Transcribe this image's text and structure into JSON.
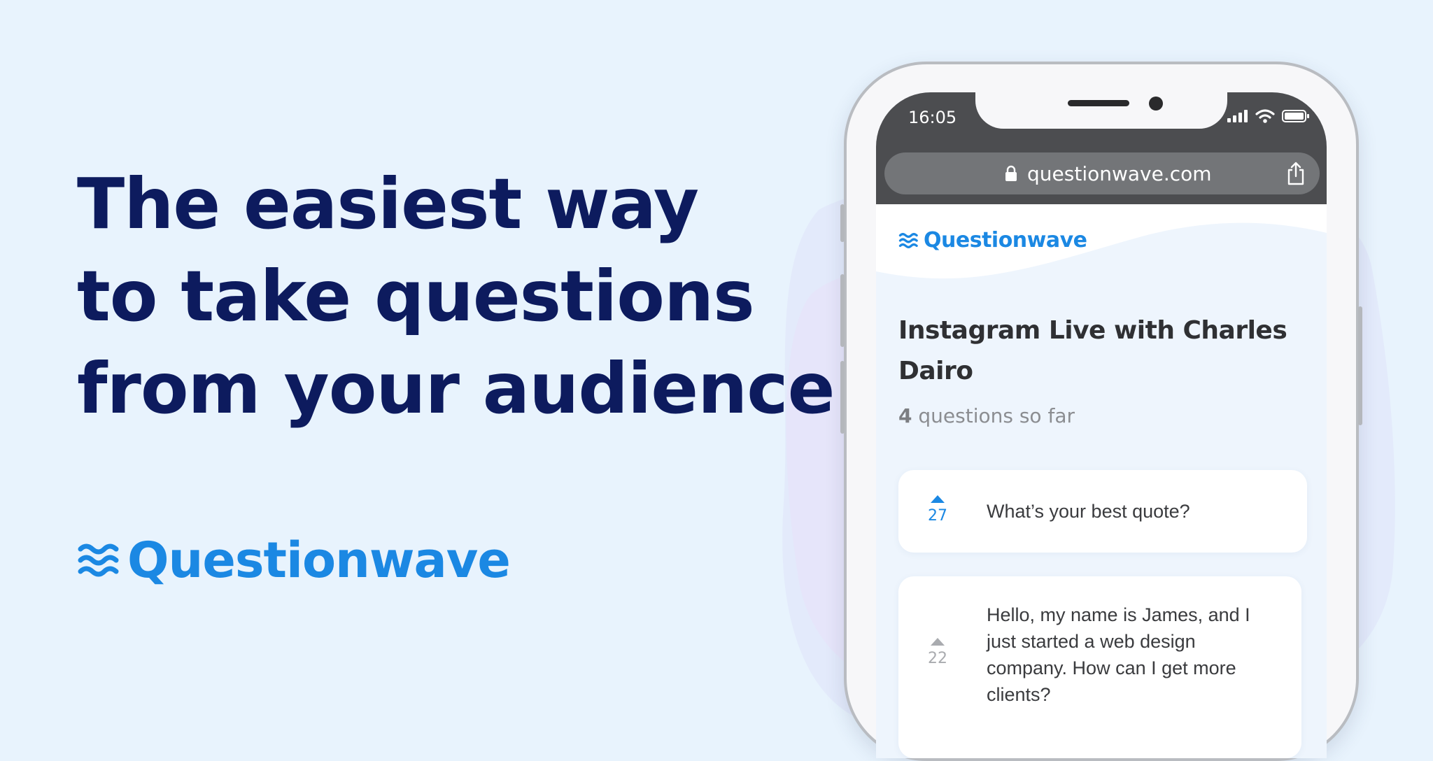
{
  "headline": {
    "lines": [
      "The easiest way",
      "to take questions",
      "from your audience"
    ]
  },
  "brand": {
    "name": "Questionwave",
    "icon": "wave-icon"
  },
  "phone": {
    "status_bar": {
      "time": "16:05",
      "icons": [
        "signal-icon",
        "wifi-icon",
        "battery-icon"
      ]
    },
    "browser": {
      "url": "questionwave.com",
      "icons": [
        "lock-icon",
        "share-icon"
      ]
    },
    "site": {
      "logo": "Questionwave",
      "event_title": "Instagram Live with Charles Dairo",
      "question_count": "4",
      "question_count_suffix": " questions so far",
      "questions": [
        {
          "votes": "27",
          "text": "What’s your best quote?",
          "upvoted": true
        },
        {
          "votes": "22",
          "text": "Hello, my name is James, and I just started a web design company. How can I get more clients?",
          "upvoted": false
        }
      ]
    }
  },
  "colors": {
    "background": "#e8f3fd",
    "headline": "#0d1b5e",
    "brand_blue": "#1b88e3",
    "status_bar": "#4c4d50",
    "vote_active": "#1b88e3",
    "vote_inactive": "#a9abaf"
  }
}
